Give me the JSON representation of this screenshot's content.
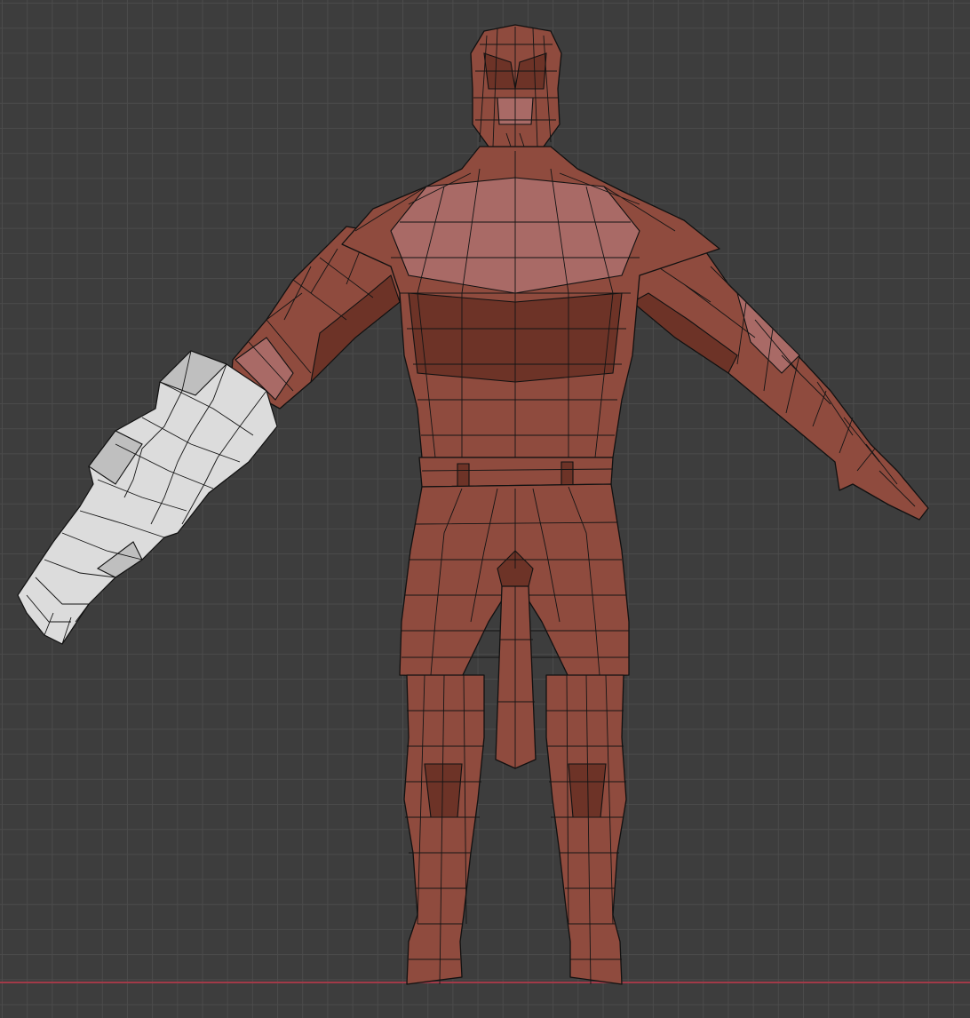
{
  "viewport": {
    "background": "#3d3d3d",
    "grid_color": "#4b4b4b",
    "x_axis_color": "#a23a48",
    "mesh_color": "#8f4b3e",
    "selected_color": "#dcdcdc"
  }
}
